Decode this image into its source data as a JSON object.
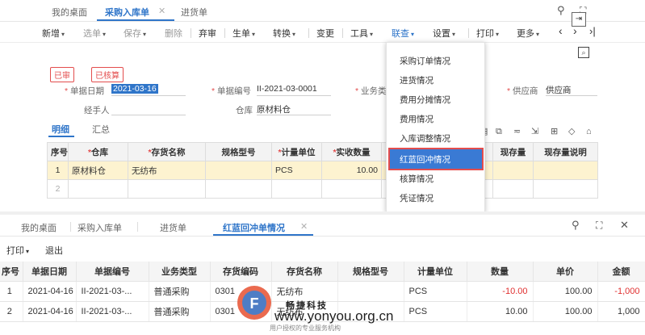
{
  "top": {
    "tabs": [
      {
        "label": "我的桌面"
      },
      {
        "label": "采购入库单"
      },
      {
        "label": "进货单"
      }
    ],
    "toolbar": [
      "新增",
      "选单",
      "保存",
      "删除",
      "弃审",
      "生单",
      "转换",
      "变更",
      "工具",
      "联查",
      "设置",
      "打印",
      "更多"
    ],
    "stamps": [
      "已审",
      "已核算"
    ],
    "fields": {
      "date_label": "单据日期",
      "date_value": "2021-03-16",
      "code_label": "单据编号",
      "code_value": "II-2021-03-0001",
      "biz_label": "业务类",
      "vendor_label": "供应商",
      "vendor_value": "供应商",
      "handler_label": "经手人",
      "warehouse_label": "仓库",
      "warehouse_value": "原材料仓"
    },
    "subtabs": [
      "明细",
      "汇总"
    ],
    "grid": {
      "headers": [
        "序号",
        "仓库",
        "存货名称",
        "规格型号",
        "计量单位",
        "实收数量",
        "现存量",
        "现存量说明"
      ],
      "rows": [
        {
          "no": "1",
          "wh": "原材料仓",
          "name": "无纺布",
          "spec": "",
          "unit": "PCS",
          "qty": "10.00"
        },
        {
          "no": "2",
          "wh": "",
          "name": "",
          "spec": "",
          "unit": "",
          "qty": ""
        }
      ]
    },
    "menu": {
      "items": [
        "采购订单情况",
        "进货情况",
        "费用分摊情况",
        "费用情况",
        "入库调整情况",
        "红蓝回冲情况",
        "核算情况",
        "凭证情况"
      ],
      "selected": "红蓝回冲情况"
    }
  },
  "bottom": {
    "tabs": [
      {
        "label": "我的桌面"
      },
      {
        "label": "采购入库单"
      },
      {
        "label": "进货单"
      },
      {
        "label": "红蓝回冲单情况"
      }
    ],
    "actions": [
      "打印",
      "退出"
    ],
    "grid": {
      "headers": [
        "序号",
        "单据日期",
        "单据编号",
        "业务类型",
        "存货编码",
        "存货名称",
        "规格型号",
        "计量单位",
        "数量",
        "单价",
        "金额"
      ],
      "rows": [
        {
          "no": "1",
          "date": "2021-04-16",
          "code": "II-2021-03-...",
          "type": "普通采购",
          "inv": "0301",
          "name": "无纺布",
          "spec": "",
          "unit": "PCS",
          "qty": "-10.00",
          "price": "100.00",
          "amt": "-1,000"
        },
        {
          "no": "2",
          "date": "2021-04-16",
          "code": "II-2021-03-...",
          "type": "普通采购",
          "inv": "0301",
          "name": "无纺布",
          "spec": "",
          "unit": "PCS",
          "qty": "10.00",
          "price": "100.00",
          "amt": "1,000"
        }
      ]
    }
  },
  "watermark": {
    "cn": "畅捷科技",
    "url": "www.yonyou.org.cn",
    "sub": "用户授权的专业服务机构"
  }
}
